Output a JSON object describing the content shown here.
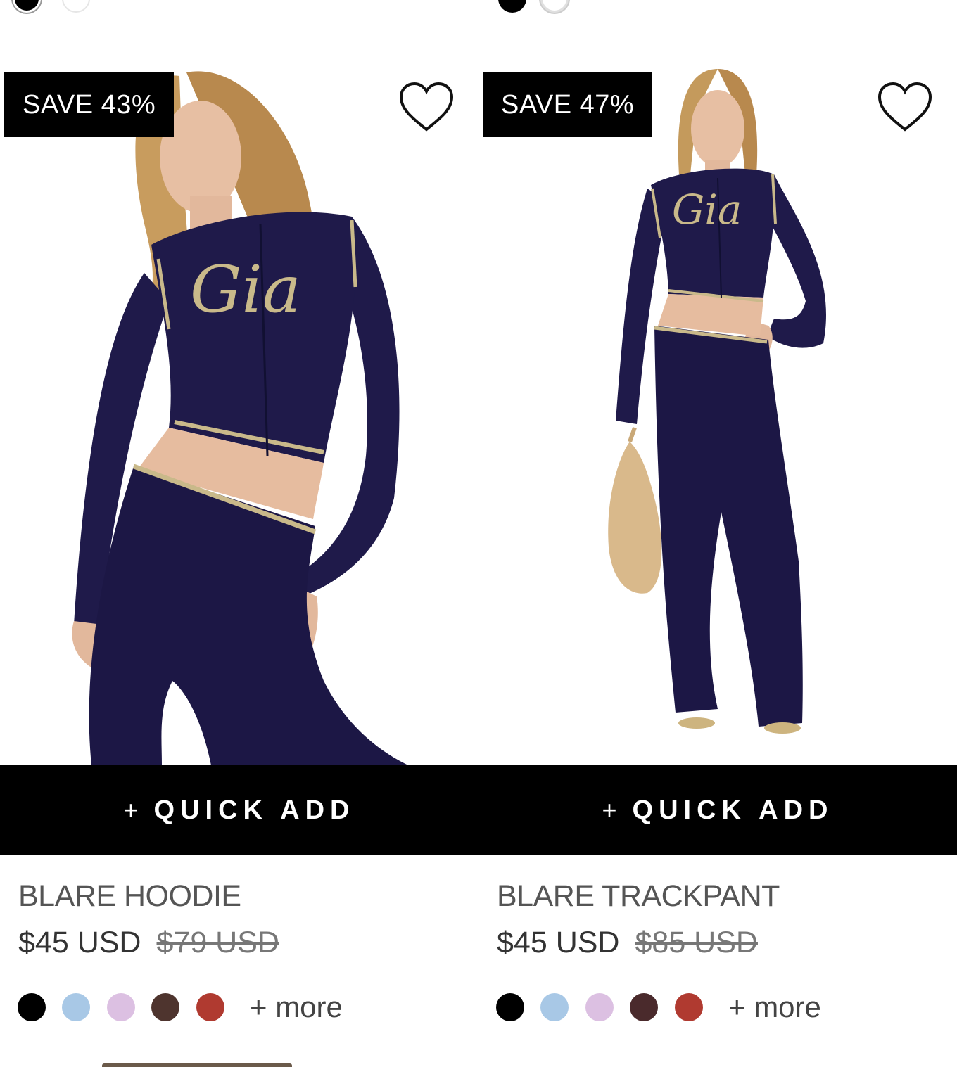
{
  "products": [
    {
      "badge": "SAVE 43%",
      "name": "BLARE HOODIE",
      "price": "$45 USD",
      "compare_price": "$79 USD",
      "quick_add_plus": "+",
      "quick_add_label": "QUICK ADD",
      "more_label": "+ more",
      "image_text": "Gia",
      "swatch_colors": [
        "#000000",
        "#a8c8e6",
        "#dcc0e2",
        "#4e342e",
        "#b03a30"
      ]
    },
    {
      "badge": "SAVE 47%",
      "name": "BLARE TRACKPANT",
      "price": "$45 USD",
      "compare_price": "$85 USD",
      "quick_add_plus": "+",
      "quick_add_label": "QUICK ADD",
      "more_label": "+ more",
      "image_text": "Gia",
      "swatch_colors": [
        "#000000",
        "#a8c8e6",
        "#dcc0e2",
        "#4a2a2c",
        "#b03a30"
      ]
    }
  ],
  "colors": {
    "garment_navy": "#1f1a4a",
    "script_gold": "#c9b98a",
    "skin": "#e8c0a5",
    "hair": "#c49a5c",
    "badge_bg": "#000000",
    "quick_add_bg": "#000000"
  },
  "icons": {
    "wishlist": "heart-outline-icon"
  }
}
